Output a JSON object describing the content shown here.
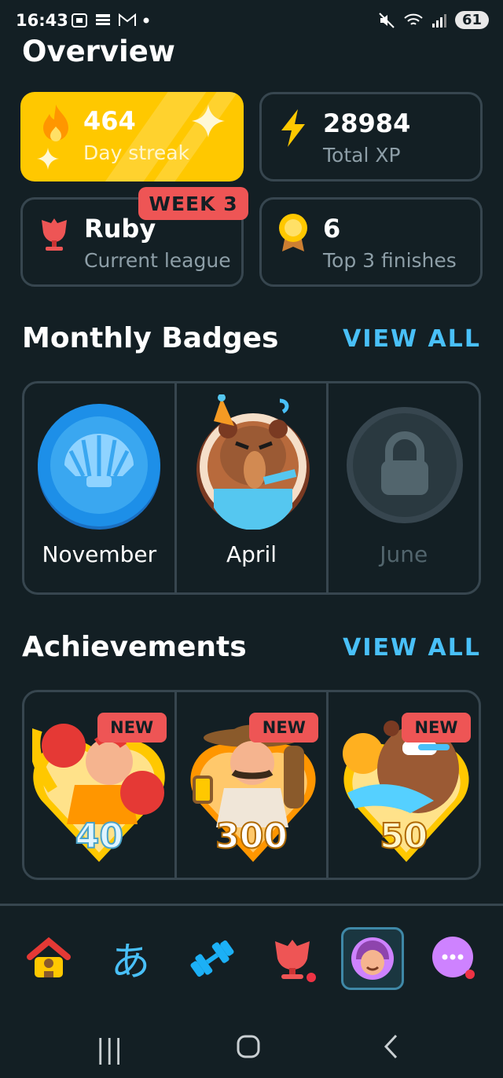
{
  "status_bar": {
    "time": "16:43",
    "battery": "61"
  },
  "page_title": "Overview",
  "stats": {
    "streak": {
      "value": "464",
      "label": "Day streak"
    },
    "xp": {
      "value": "28984",
      "label": "Total XP"
    },
    "league": {
      "value": "Ruby",
      "label": "Current league",
      "week_badge": "WEEK 3"
    },
    "top3": {
      "value": "6",
      "label": "Top 3 finishes"
    }
  },
  "monthly_badges": {
    "title": "Monthly Badges",
    "view_all": "VIEW ALL",
    "items": [
      {
        "label": "November",
        "icon": "shell-badge-icon",
        "locked": false
      },
      {
        "label": "April",
        "icon": "party-bear-badge-icon",
        "locked": false
      },
      {
        "label": "June",
        "icon": "lock-icon",
        "locked": true
      }
    ]
  },
  "achievements": {
    "title": "Achievements",
    "view_all": "VIEW ALL",
    "items": [
      {
        "badge": "NEW",
        "value": "40",
        "icon": "boxer-achievement-icon"
      },
      {
        "badge": "NEW",
        "value": "300",
        "icon": "explorer-achievement-icon"
      },
      {
        "badge": "NEW",
        "value": "50",
        "icon": "bear-achievement-icon"
      }
    ]
  },
  "tabs": [
    {
      "name": "home",
      "icon": "home-icon",
      "glyph": ""
    },
    {
      "name": "characters",
      "icon": "hiragana-icon",
      "glyph": "あ"
    },
    {
      "name": "practice",
      "icon": "dumbbell-icon",
      "glyph": ""
    },
    {
      "name": "leagues",
      "icon": "ruby-league-icon",
      "glyph": ""
    },
    {
      "name": "profile",
      "icon": "avatar-icon",
      "glyph": ""
    },
    {
      "name": "more",
      "icon": "more-icon",
      "glyph": "···"
    }
  ],
  "colors": {
    "background": "#131f24",
    "streak": "#ffc800",
    "accent": "#49c0f8",
    "badge": "#ee5555",
    "border": "#37464f"
  }
}
